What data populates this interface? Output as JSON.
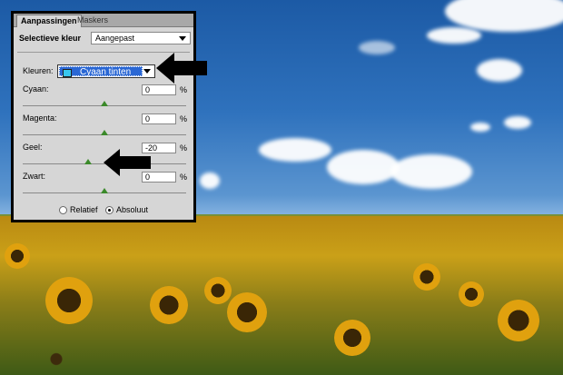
{
  "tabs": [
    {
      "label": "Aanpassingen"
    },
    {
      "label": "Maskers"
    }
  ],
  "panel": {
    "title": "Selectieve kleur",
    "preset_value": "Aangepast",
    "colors_label": "Kleuren:",
    "colors_value": "Cyaan tinten",
    "swatch_color": "#39c7ef",
    "sliders": [
      {
        "label": "Cyaan:",
        "value": "0",
        "unit": "%",
        "position_pct": 50
      },
      {
        "label": "Magenta:",
        "value": "0",
        "unit": "%",
        "position_pct": 50
      },
      {
        "label": "Geel:",
        "value": "-20",
        "unit": "%",
        "position_pct": 40
      },
      {
        "label": "Zwart:",
        "value": "0",
        "unit": "%",
        "position_pct": 50
      }
    ],
    "method": {
      "relative_label": "Relatief",
      "absolute_label": "Absoluut",
      "selected": "absolute"
    }
  },
  "icons": {
    "arrow1": "left-arrow-icon",
    "arrow2": "left-arrow-icon"
  }
}
